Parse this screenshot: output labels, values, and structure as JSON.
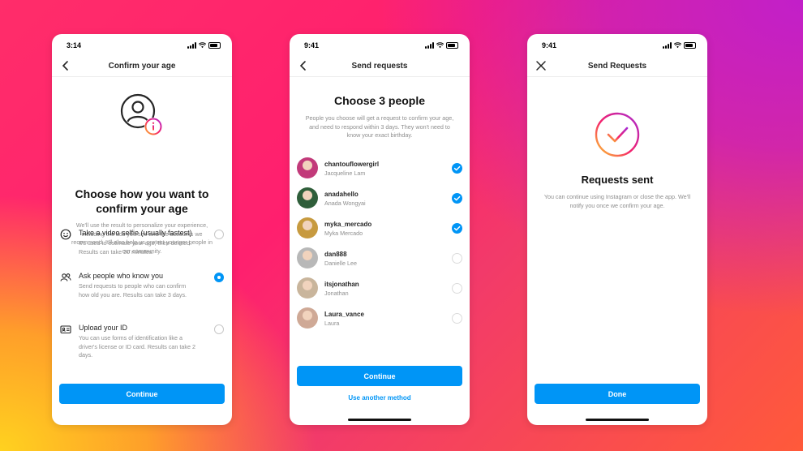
{
  "colors": {
    "accent": "#0095f6",
    "text": "#262626",
    "secondary": "#8e8e8e"
  },
  "screens": [
    {
      "time": "3:14",
      "nav": {
        "title": "Confirm your age",
        "left_icon": "chevron-left-icon"
      },
      "hero_icon": "user-info-icon",
      "heading": "Choose how you want to confirm your age",
      "description": "We'll use the result to personalize your experience, including the ads you see and the accounts we recommend. It'll also help us protect younger people in our community.",
      "options": [
        {
          "icon": "face-icon",
          "title": "Take a video selfie (usually fastest)",
          "desc": "It's used to estimate your age, then deleted. Results can take 20 minutes.",
          "selected": false
        },
        {
          "icon": "people-icon",
          "title": "Ask people who know you",
          "desc": "Send requests to people who can confirm how old you are. Results can take 3 days.",
          "selected": true
        },
        {
          "icon": "id-card-icon",
          "title": "Upload your ID",
          "desc": "You can use forms of identification like a driver's license or ID card. Results can take 2 days.",
          "selected": false
        }
      ],
      "button": "Continue"
    },
    {
      "time": "9:41",
      "nav": {
        "title": "Send requests",
        "left_icon": "chevron-left-icon"
      },
      "heading": "Choose 3 people",
      "description": "People you choose will get a request to confirm your age, and need to respond within 3 days. They won't need to know your exact birthday.",
      "people": [
        {
          "username": "chantouflowergirl",
          "name": "Jacqueline Lam",
          "checked": true,
          "color": "#c23a7a"
        },
        {
          "username": "anadahello",
          "name": "Anada Wongyai",
          "checked": true,
          "color": "#2f5e3a"
        },
        {
          "username": "myka_mercado",
          "name": "Myka Mercado",
          "checked": true,
          "color": "#c79a3f"
        },
        {
          "username": "dan888",
          "name": "Danielle Lee",
          "checked": false,
          "color": "#b8b8b8"
        },
        {
          "username": "itsjonathan",
          "name": "Jonathan",
          "checked": false,
          "color": "#c9b59c"
        },
        {
          "username": "Laura_vance",
          "name": "Laura",
          "checked": false,
          "color": "#cfa996"
        }
      ],
      "button": "Continue",
      "link": "Use another method"
    },
    {
      "time": "9:41",
      "nav": {
        "title": "Send Requests",
        "left_icon": "close-icon"
      },
      "hero_icon": "check-circle-icon",
      "heading": "Requests sent",
      "description": "You can continue using Instagram or close the app. We'll notify you once we confirm your age.",
      "button": "Done"
    }
  ]
}
